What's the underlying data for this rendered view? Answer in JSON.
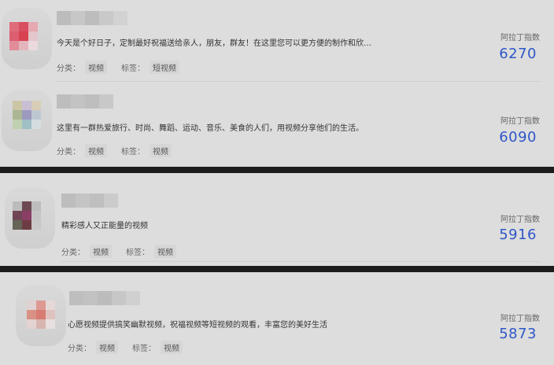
{
  "items": [
    {
      "description": "今天是个好日子，定制最好祝福送给亲人，朋友，群友！在这里您可以更方便的制作和欣…",
      "category_label": "分类：",
      "category_value": "视频",
      "tag_label": "标签：",
      "tag_value": "短视频",
      "score_label": "阿拉丁指数",
      "score_value": "6270"
    },
    {
      "description": "这里有一群热爱旅行、时尚、舞蹈、运动、音乐、美食的人们，用视频分享他们的生活。",
      "category_label": "分类：",
      "category_value": "视频",
      "tag_label": "标签：",
      "tag_value": "视频",
      "score_label": "阿拉丁指数",
      "score_value": "6090"
    },
    {
      "description": "精彩感人又正能量的视频",
      "category_label": "分类：",
      "category_value": "视频",
      "tag_label": "标签：",
      "tag_value": "视频",
      "score_label": "阿拉丁指数",
      "score_value": "5916"
    },
    {
      "description": "心愿视频提供搞笑幽默视频，祝福视频等短视频的观看，丰富您的美好生活",
      "category_label": "分类：",
      "category_value": "视频",
      "tag_label": "标签：",
      "tag_value": "视频",
      "score_label": "阿拉丁指数",
      "score_value": "5873"
    }
  ],
  "colors": {
    "accent_score": "#2f56c8",
    "separator": "#1c1c1c",
    "background": "#dddddd"
  },
  "icons": {
    "heart-logo": "heart-icon"
  }
}
